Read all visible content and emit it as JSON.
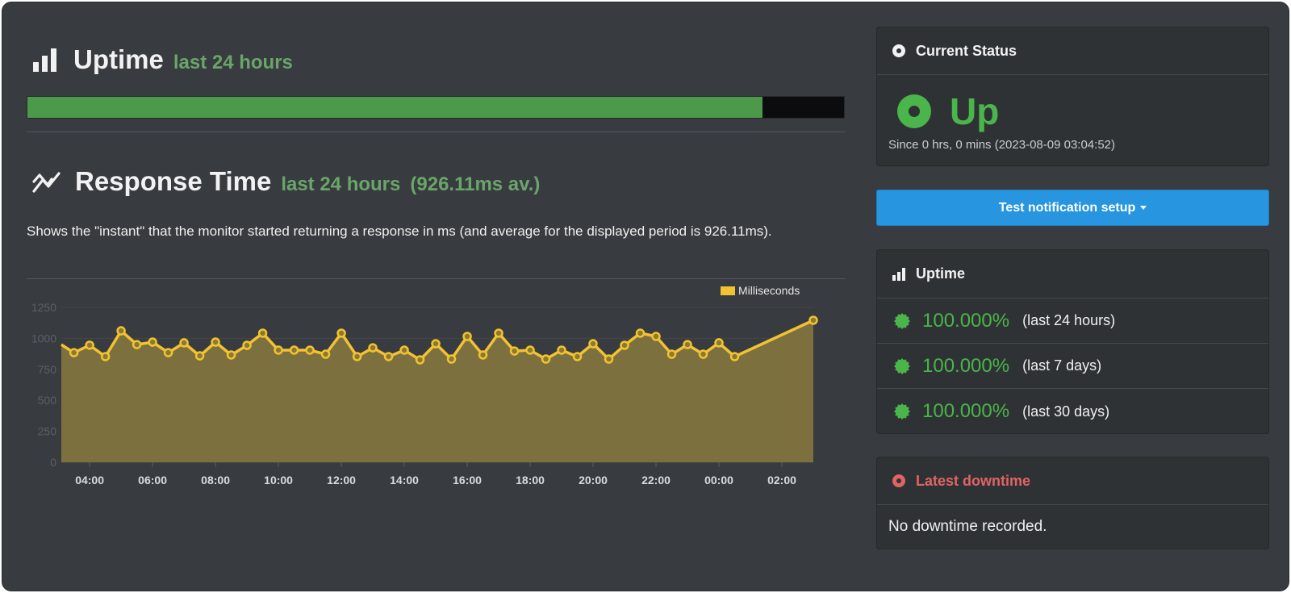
{
  "uptime_section": {
    "title": "Uptime",
    "subtitle": "last 24 hours",
    "bar_uptime_fraction": 0.9,
    "icon": "bar-chart-icon"
  },
  "response_section": {
    "title": "Response Time",
    "subtitle": "last 24 hours",
    "average": "(926.11ms av.)",
    "description": "Shows the \"instant\" that the monitor started returning a response in ms (and average for the displayed period is 926.11ms).",
    "icon": "line-chart-icon"
  },
  "chart_data": {
    "type": "area",
    "title": "",
    "xlabel": "",
    "ylabel": "",
    "legend": {
      "label": "Milliseconds",
      "placement": "top-right"
    },
    "grid": true,
    "ylim": [
      0,
      1250
    ],
    "yticks": [
      0,
      250,
      500,
      750,
      1000,
      1250
    ],
    "xticks": [
      "04:00",
      "06:00",
      "08:00",
      "10:00",
      "12:00",
      "14:00",
      "16:00",
      "18:00",
      "20:00",
      "22:00",
      "00:00",
      "02:00"
    ],
    "x_range_hours": [
      3.1,
      27.0
    ],
    "series": [
      {
        "name": "Milliseconds",
        "color": "#f2c233",
        "fill": "#7d703f",
        "points": [
          [
            3.1,
            950
          ],
          [
            3.5,
            885
          ],
          [
            4.0,
            945
          ],
          [
            4.5,
            853
          ],
          [
            5.0,
            1061
          ],
          [
            5.5,
            950
          ],
          [
            6.0,
            970
          ],
          [
            6.5,
            885
          ],
          [
            7.0,
            964
          ],
          [
            7.5,
            859
          ],
          [
            8.0,
            970
          ],
          [
            8.5,
            866
          ],
          [
            9.0,
            944
          ],
          [
            9.5,
            1042
          ],
          [
            10.0,
            905
          ],
          [
            10.5,
            905
          ],
          [
            11.0,
            905
          ],
          [
            11.5,
            872
          ],
          [
            12.0,
            1042
          ],
          [
            12.5,
            853
          ],
          [
            13.0,
            924
          ],
          [
            13.5,
            853
          ],
          [
            14.0,
            905
          ],
          [
            14.5,
            827
          ],
          [
            15.0,
            957
          ],
          [
            15.5,
            833
          ],
          [
            16.0,
            1016
          ],
          [
            16.5,
            866
          ],
          [
            17.0,
            1042
          ],
          [
            17.5,
            898
          ],
          [
            18.0,
            905
          ],
          [
            18.5,
            833
          ],
          [
            19.0,
            905
          ],
          [
            19.5,
            853
          ],
          [
            20.0,
            957
          ],
          [
            20.5,
            833
          ],
          [
            21.0,
            944
          ],
          [
            21.5,
            1042
          ],
          [
            22.0,
            1016
          ],
          [
            22.5,
            872
          ],
          [
            23.0,
            950
          ],
          [
            23.5,
            872
          ],
          [
            24.0,
            964
          ],
          [
            24.5,
            853
          ],
          [
            27.0,
            1146
          ]
        ]
      }
    ]
  },
  "current_status": {
    "header": "Current Status",
    "status": "Up",
    "since": "Since 0 hrs, 0 mins (2023-08-09 03:04:52)",
    "color": "#4ab54a"
  },
  "notify_button": {
    "label": "Test notification setup"
  },
  "uptime_panel": {
    "header": "Uptime",
    "rows": [
      {
        "pct": "100.000%",
        "period": "(last 24 hours)"
      },
      {
        "pct": "100.000%",
        "period": "(last 7 days)"
      },
      {
        "pct": "100.000%",
        "period": "(last 30 days)"
      }
    ]
  },
  "latest_downtime": {
    "header": "Latest downtime",
    "text": "No downtime recorded.",
    "color": "#e06464"
  }
}
